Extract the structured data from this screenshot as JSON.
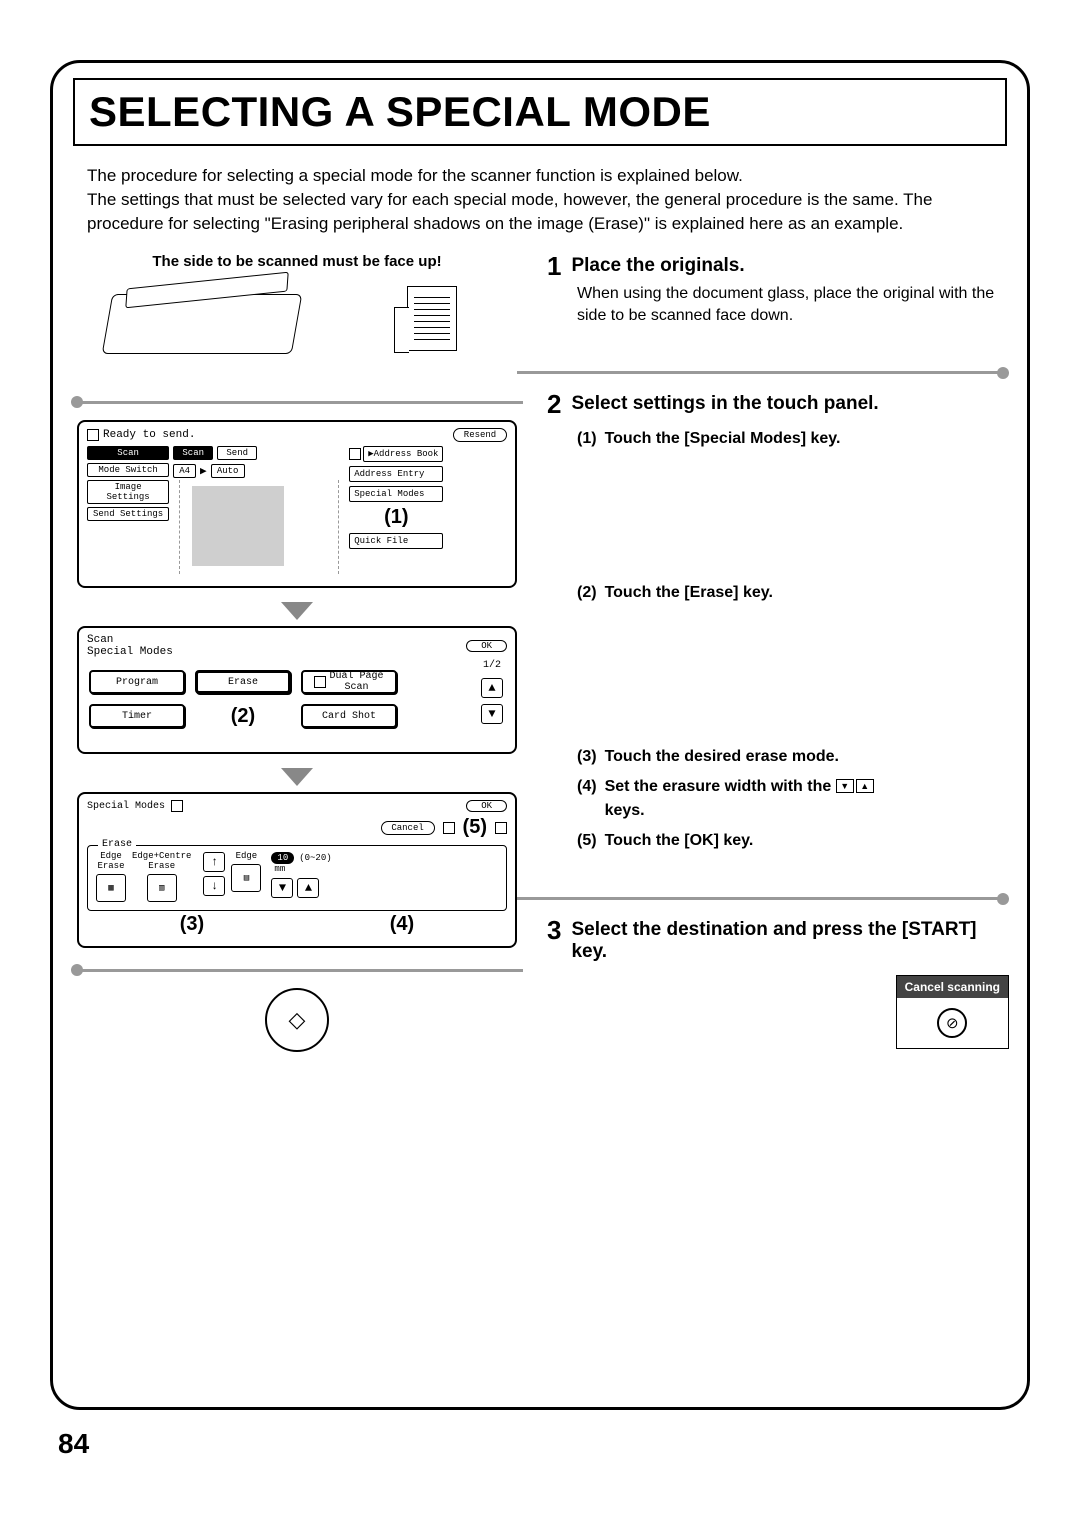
{
  "page_number": "84",
  "title": "SELECTING A SPECIAL MODE",
  "intro": "The procedure for selecting a special mode for the scanner function is explained below.\nThe settings that must be selected vary for each special mode, however, the general procedure is the same. The procedure for selecting \"Erasing peripheral shadows on the image (Erase)\" is explained here as an example.",
  "note_caption": "The side to be scanned must be face up!",
  "steps": {
    "s1": {
      "num": "1",
      "title": "Place the originals.",
      "body": "When using the document glass, place the original with the side to be scanned face down."
    },
    "s2": {
      "num": "2",
      "title": "Select settings in the touch panel.",
      "items": {
        "i1": {
          "n": "(1)",
          "t": "Touch the [Special Modes] key."
        },
        "i2": {
          "n": "(2)",
          "t": "Touch the [Erase] key."
        },
        "i3": {
          "n": "(3)",
          "t": "Touch the desired erase mode."
        },
        "i4": {
          "n": "(4)",
          "t": "Set the erasure width with the"
        },
        "i4b": {
          "t": "keys."
        },
        "i5": {
          "n": "(5)",
          "t": "Touch the [OK] key."
        }
      }
    },
    "s3": {
      "num": "3",
      "title": "Select the destination and press the [START] key."
    }
  },
  "cancel_caption": "Cancel scanning",
  "screen1": {
    "ready": "Ready to send.",
    "resend": "Resend",
    "left_buttons": {
      "scan": "Scan",
      "mode_switch": "Mode Switch",
      "image": "Image\nSettings",
      "send_settings": "Send Settings"
    },
    "tabs": {
      "scan": "Scan",
      "send": "Send"
    },
    "paper": "A4",
    "auto": "Auto",
    "right_buttons": {
      "addr_book": "Address Book",
      "addr_entry": "Address Entry",
      "special": "Special Modes",
      "quick": "Quick File"
    },
    "callout": "(1)"
  },
  "screen2": {
    "title": "Scan",
    "title2": "Special Modes",
    "ok": "OK",
    "page": "1/2",
    "buttons": {
      "program": "Program",
      "erase": "Erase",
      "dual": "Dual Page\nScan",
      "timer": "Timer",
      "card": "Card Shot"
    },
    "callout": "(2)"
  },
  "screen3": {
    "title": "Special Modes",
    "ok": "OK",
    "cancel": "Cancel",
    "erase": "Erase",
    "modes": {
      "edge": "Edge\nErase",
      "center": "Edge+Centre\nErase",
      "edge2": "Edge"
    },
    "value": "10",
    "range": "(0~20)",
    "unit": "mm",
    "callouts": {
      "c3": "(3)",
      "c4": "(4)",
      "c5": "(5)"
    }
  }
}
